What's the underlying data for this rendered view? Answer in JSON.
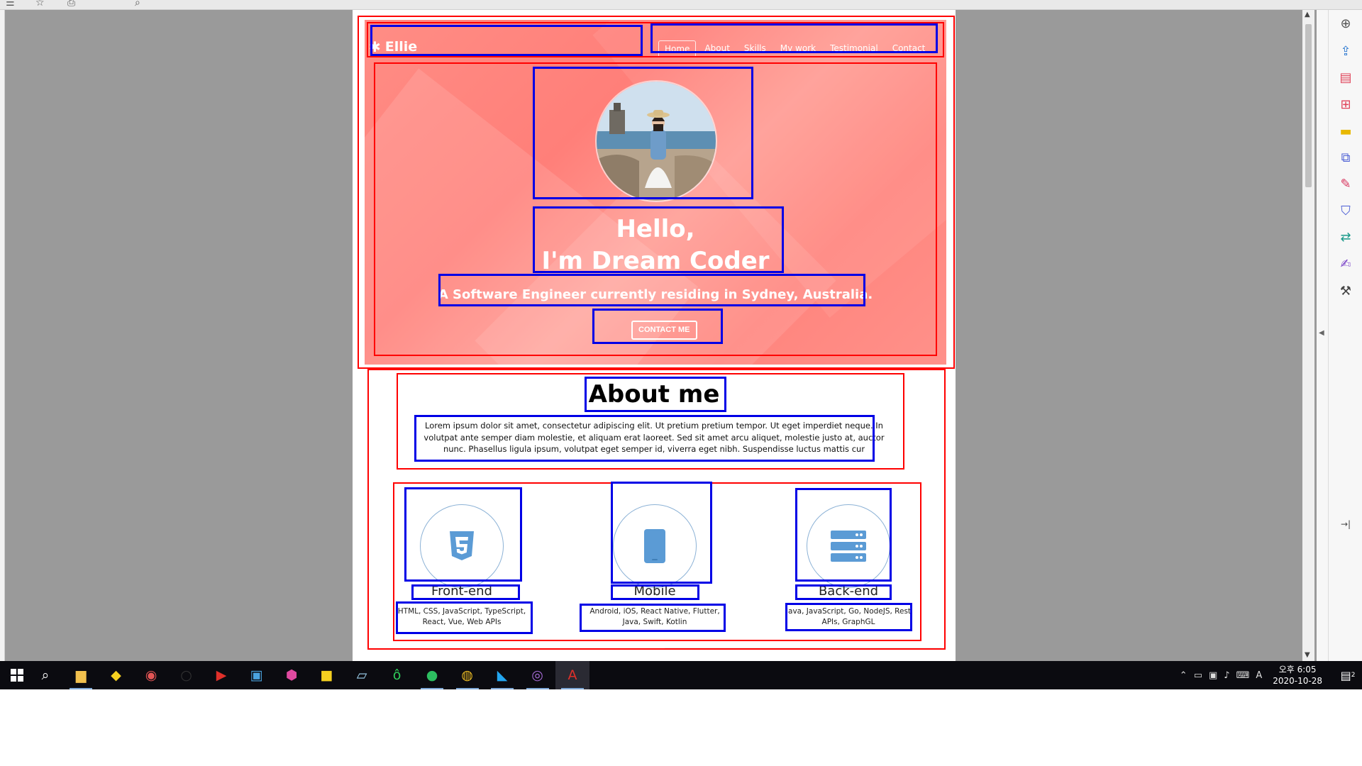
{
  "viewer": {
    "toolbar_icons": [
      "menu-icon",
      "star-icon",
      "print-icon",
      "search-icon"
    ],
    "right_tools": [
      {
        "name": "zoom-icon",
        "glyph": "⊕",
        "color": "#555555"
      },
      {
        "name": "export-pdf-icon",
        "glyph": "⇪",
        "color": "#2e7ad1"
      },
      {
        "name": "organize-pages-icon",
        "glyph": "▤",
        "color": "#e0445a"
      },
      {
        "name": "create-pdf-icon",
        "glyph": "⊞",
        "color": "#e0445a"
      },
      {
        "name": "comment-icon",
        "glyph": "▬",
        "color": "#e8b800"
      },
      {
        "name": "combine-files-icon",
        "glyph": "⧉",
        "color": "#4c5fd5"
      },
      {
        "name": "fill-sign-icon",
        "glyph": "✎",
        "color": "#d7335c"
      },
      {
        "name": "protect-icon",
        "glyph": "⛉",
        "color": "#4c5fd5"
      },
      {
        "name": "send-for-review-icon",
        "glyph": "⇄",
        "color": "#1a9a8a"
      },
      {
        "name": "request-signature-icon",
        "glyph": "✍",
        "color": "#7b45c8"
      },
      {
        "name": "more-tools-icon",
        "glyph": "⚒",
        "color": "#444444"
      }
    ],
    "collapse_panel_icon": "→|"
  },
  "site": {
    "brand": "Ellie",
    "nav": [
      "Home",
      "About",
      "Skills",
      "My work",
      "Testimonial",
      "Contact"
    ],
    "hero_title_line1": "Hello,",
    "hero_title_line2": "I'm Dream Coder",
    "hero_subtitle": "A Software Engineer currently residing in Sydney, Australia.",
    "contact_button": "CONTACT ME",
    "about_title": "About me",
    "about_text": "Lorem ipsum dolor sit amet, consectetur adipiscing elit. Ut pretium pretium tempor. Ut eget imperdiet neque. In volutpat ante semper diam molestie, et aliquam erat laoreet. Sed sit amet arcu aliquet, molestie justo at, auctor nunc. Phasellus ligula ipsum, volutpat eget semper id, viverra eget nibh. Suspendisse luctus mattis cur",
    "skills": [
      {
        "title": "Front-end",
        "desc": "HTML, CSS, JavaScript, TypeScript, React, Vue, Web APIs",
        "icon": "html5-icon"
      },
      {
        "title": "Mobile",
        "desc": "Android, iOS, React Native, Flutter, Java, Swift, Kotlin",
        "icon": "mobile-icon"
      },
      {
        "title": "Back-end",
        "desc": "Java, JavaScript, Go, NodeJS, Rest APIs, GraphGL",
        "icon": "server-icon"
      }
    ],
    "accent_color": "#ff8a82",
    "icon_color": "#5b9bd5",
    "annotation_colors": {
      "section": "#ff0000",
      "element": "#0000e6"
    }
  },
  "taskbar": {
    "apps": [
      {
        "name": "file-explorer-icon",
        "glyph": "▆",
        "color": "#f2c14e",
        "running": true
      },
      {
        "name": "sticky-app-icon",
        "glyph": "◆",
        "color": "#f5d020",
        "running": false
      },
      {
        "name": "paint-app-icon",
        "glyph": "◉",
        "color": "#e25555",
        "running": false
      },
      {
        "name": "circle-app-icon",
        "glyph": "○",
        "color": "#333333",
        "running": false
      },
      {
        "name": "media-player-icon",
        "glyph": "▶",
        "color": "#e0302a",
        "running": false
      },
      {
        "name": "store-app-icon",
        "glyph": "▣",
        "color": "#4aa3df",
        "running": false
      },
      {
        "name": "security-app-icon",
        "glyph": "⬢",
        "color": "#e04aa0",
        "running": false
      },
      {
        "name": "sticky-notes-icon",
        "glyph": "■",
        "color": "#f5d020",
        "running": false
      },
      {
        "name": "notepad-app-icon",
        "glyph": "▱",
        "color": "#9fd3f0",
        "running": false
      },
      {
        "name": "green-app-icon",
        "glyph": "ô",
        "color": "#2fcf5a",
        "running": false
      },
      {
        "name": "evernote-icon",
        "glyph": "●",
        "color": "#2dbe60",
        "running": true
      },
      {
        "name": "chrome-icon",
        "glyph": "◍",
        "color": "#e8b923",
        "running": true
      },
      {
        "name": "vscode-icon",
        "glyph": "◣",
        "color": "#23a6f0",
        "running": true
      },
      {
        "name": "purple-app-icon",
        "glyph": "◎",
        "color": "#a66bd6",
        "running": true
      },
      {
        "name": "acrobat-icon",
        "glyph": "A",
        "color": "#e0302a",
        "running": true,
        "active": true
      }
    ],
    "ime_label": "A",
    "clock_ampm": "오후",
    "clock_time": "6:05",
    "clock_date": "2020-10-28",
    "notification_count": "2"
  }
}
